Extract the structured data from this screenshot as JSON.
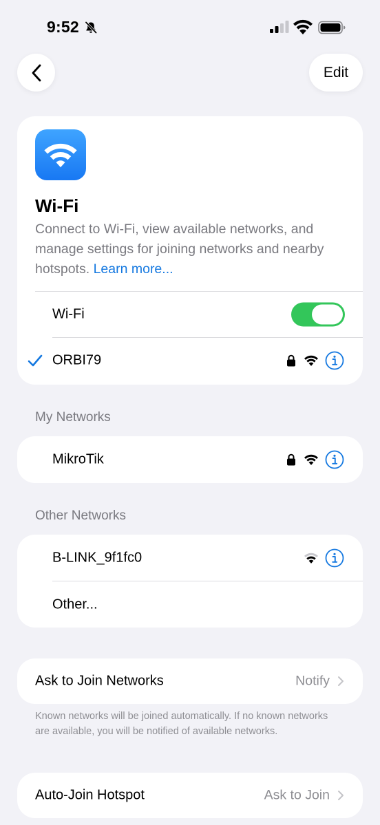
{
  "status_bar": {
    "time": "9:52",
    "icons": [
      "bell-slash-icon",
      "cellular-signal-icon",
      "wifi-icon",
      "battery-icon"
    ]
  },
  "nav": {
    "back_icon": "chevron-left-icon",
    "edit_label": "Edit"
  },
  "hero": {
    "icon": "wifi-icon",
    "title": "Wi-Fi",
    "description": "Connect to Wi-Fi, view available networks, and manage settings for joining networks and nearby hotspots.",
    "learn_more": "Learn more..."
  },
  "wifi_toggle": {
    "label": "Wi-Fi",
    "on": true
  },
  "connected_network": {
    "name": "ORBI79",
    "secured": true
  },
  "my_networks": {
    "header": "My Networks",
    "items": [
      {
        "name": "MikroTik",
        "secured": true
      }
    ]
  },
  "other_networks": {
    "header": "Other Networks",
    "items": [
      {
        "name": "B-LINK_9f1fc0",
        "secured": false
      }
    ],
    "other_label": "Other..."
  },
  "ask_to_join": {
    "label": "Ask to Join Networks",
    "value": "Notify",
    "footnote": "Known networks will be joined automatically. If no known networks are available, you will be notified of available networks."
  },
  "auto_join_hotspot": {
    "label": "Auto-Join Hotspot",
    "value": "Ask to Join"
  },
  "colors": {
    "background": "#f2f2f7",
    "accent": "#1478e0",
    "toggle_on": "#33c65a",
    "secondary_text": "#7a7a80"
  }
}
